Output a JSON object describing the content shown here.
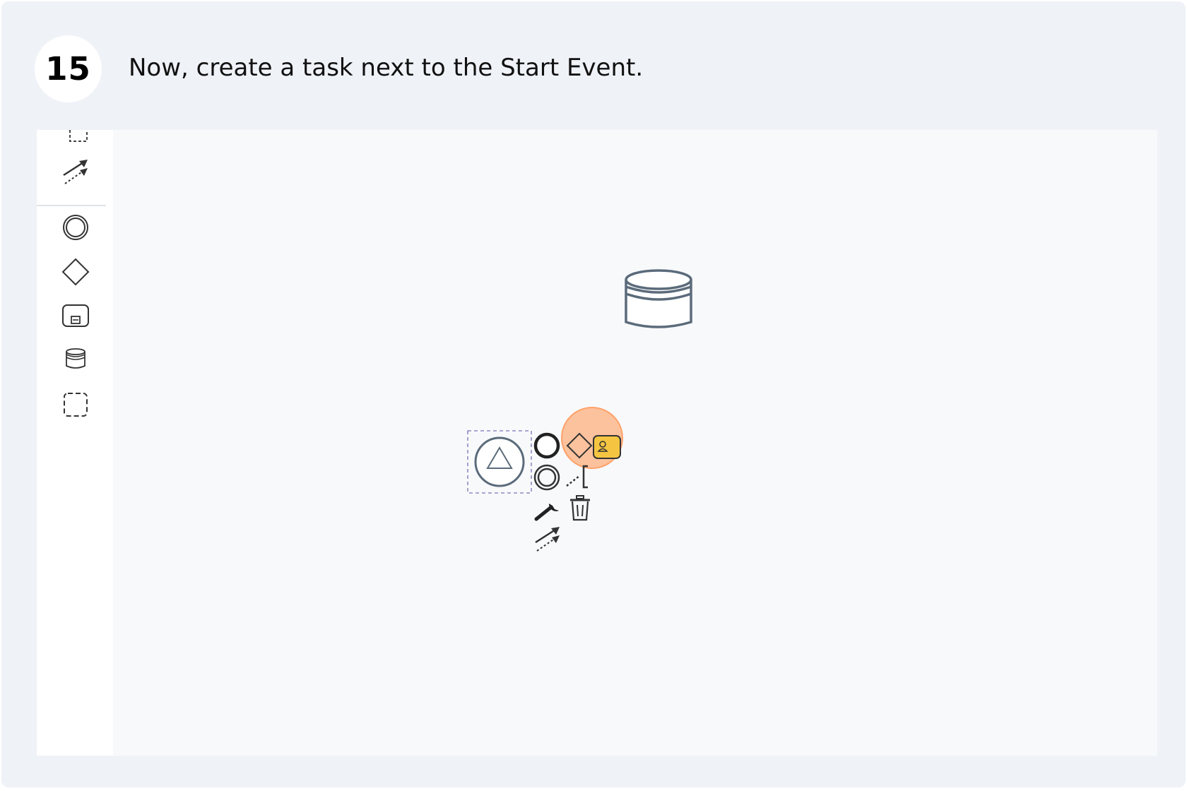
{
  "step": {
    "number": "15",
    "instruction": "Now, create a task next to the Start Event."
  },
  "palette": {
    "tools": [
      "lasso-tool-icon",
      "connect-tool-icon",
      "create-start-event-icon",
      "create-gateway-icon",
      "create-subprocess-icon",
      "create-data-store-icon",
      "create-group-icon"
    ]
  },
  "canvas": {
    "elements": [
      "data-store-shape",
      "start-event-shape"
    ]
  },
  "context_pad": {
    "items": [
      "append-end-event-icon",
      "append-gateway-icon",
      "append-task-icon",
      "append-intermediate-event-icon",
      "append-text-annotation-icon",
      "change-type-icon",
      "delete-icon",
      "connect-icon"
    ]
  },
  "colors": {
    "frame_bg": "#eff2f7",
    "canvas_bg": "#f8f9fb",
    "shape_stroke": "#5b6b7b",
    "task_highlight": "#f5c542",
    "click_highlight": "#ff9650"
  }
}
